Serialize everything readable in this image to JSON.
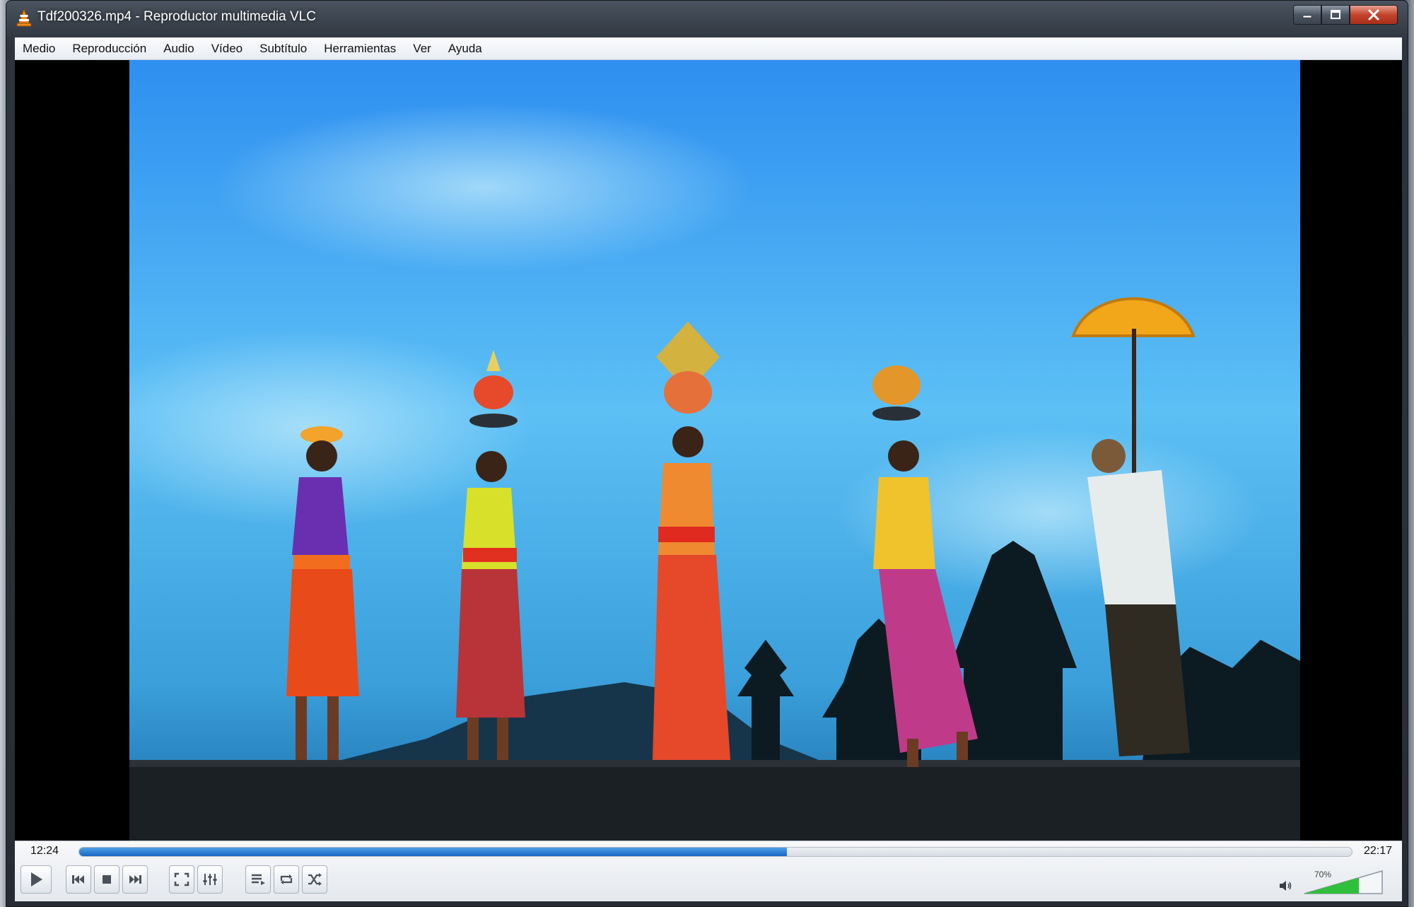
{
  "window": {
    "title": "Tdf200326.mp4 - Reproductor multimedia VLC",
    "icon": "vlc-cone-icon"
  },
  "menubar": {
    "items": [
      "Medio",
      "Reproducción",
      "Audio",
      "Vídeo",
      "Subtítulo",
      "Herramientas",
      "Ver",
      "Ayuda"
    ]
  },
  "playback": {
    "elapsed": "12:24",
    "total": "22:17",
    "progress_fraction": 0.556
  },
  "controls": {
    "buttons": [
      "play-icon",
      "previous-icon",
      "stop-icon",
      "next-icon",
      "fullscreen-icon",
      "extended-settings-icon",
      "playlist-icon",
      "loop-icon",
      "shuffle-icon"
    ]
  },
  "volume": {
    "label": "70%",
    "level_fraction": 0.7,
    "icon": "speaker-icon"
  },
  "colors": {
    "progress": "#1667c4",
    "volume": "#2fbf3a",
    "close_button": "#c3432b"
  }
}
